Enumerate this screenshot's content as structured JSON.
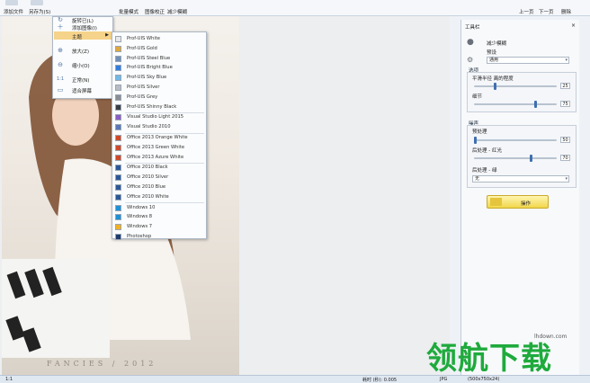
{
  "toolbar": {
    "add_file": "添加文件",
    "save_as": "另存为(S)",
    "batch_mode": "批量模式",
    "image_correct": "图像校正",
    "reduce_blur": "减少模糊",
    "prev": "上一页",
    "next": "下一页",
    "delete": "删除"
  },
  "view_menu": {
    "items": [
      {
        "label": "旋转已(L)",
        "icon": "rotate-icon"
      },
      {
        "label": "添加图像(I)",
        "icon": "add-image-icon"
      },
      {
        "label": "主题",
        "icon": "",
        "submenu": true
      },
      {
        "label": "放大(Z)",
        "icon": "zoom-in-icon"
      },
      {
        "label": "缩小(O)",
        "icon": "zoom-out-icon"
      },
      {
        "label": "正常(N)",
        "icon": "actual-size-icon",
        "glyph": "1:1"
      },
      {
        "label": "适合屏幕",
        "icon": "fit-screen-icon"
      }
    ]
  },
  "theme_menu": {
    "items": [
      {
        "label": "Prof-UIS White",
        "color": "#e8e8e8"
      },
      {
        "label": "Prof-UIS Gold",
        "color": "#e0a83a"
      },
      {
        "label": "Prof-UIS Steel Blue",
        "color": "#6f8fb8"
      },
      {
        "label": "Prof-UIS Bright Blue",
        "color": "#2f7de0"
      },
      {
        "label": "Prof-UIS Sky Blue",
        "color": "#6fb8e8"
      },
      {
        "label": "Prof-UIS Silver",
        "color": "#b8bcc2"
      },
      {
        "label": "Prof-UIS Grey",
        "color": "#8a8e94"
      },
      {
        "label": "Prof-UIS Shinny Black",
        "color": "#3a3d42"
      },
      {
        "label": "Visual Studio Light 2015",
        "color": "#8a5cc4"
      },
      {
        "label": "Visual Studio 2010",
        "color": "#5a78b8"
      },
      {
        "label": "Office 2013 Orange White",
        "color": "#d24726"
      },
      {
        "label": "Office 2013 Green White",
        "color": "#d24726"
      },
      {
        "label": "Office 2013 Azure White",
        "color": "#d24726"
      },
      {
        "label": "Office 2010 Black",
        "color": "#2b5797"
      },
      {
        "label": "Office 2010 Silver",
        "color": "#2b5797"
      },
      {
        "label": "Office 2010 Blue",
        "color": "#2b5797"
      },
      {
        "label": "Office 2010 White",
        "color": "#2b5797"
      },
      {
        "label": "Windows 10",
        "color": "#1e90d8"
      },
      {
        "label": "Windows 8",
        "color": "#1e90d8"
      },
      {
        "label": "Windows 7",
        "color": "#f2b01e"
      },
      {
        "label": "Photoshop",
        "color": "#1f3b6e"
      }
    ]
  },
  "photo": {
    "watermark": "FANCIES / 2012"
  },
  "panel": {
    "title": "工具栏",
    "tool_name": "减少模糊",
    "preset_label": "预设",
    "preset_value": "通用",
    "options_title": "选项",
    "smooth_label": "平滑半径 离的程度",
    "smooth_value": 25,
    "detail_label": "细节",
    "detail_value": 75,
    "noise_title": "噪声",
    "preprocess_label": "预处理",
    "preprocess_value": 50,
    "postprocess_red_label": "后处理 - 红光",
    "postprocess_red_value": 70,
    "postprocess_green_label": "后处理 - 绿",
    "postprocess_green_value": "无",
    "apply": "操作"
  },
  "status": {
    "zoom": "1:1",
    "process_time": "耗时 (秒): 0.005",
    "format": "JPG",
    "dims": "(500x750x24)"
  },
  "site_watermark": {
    "text": "领航下载",
    "url": "lhdown.com"
  }
}
